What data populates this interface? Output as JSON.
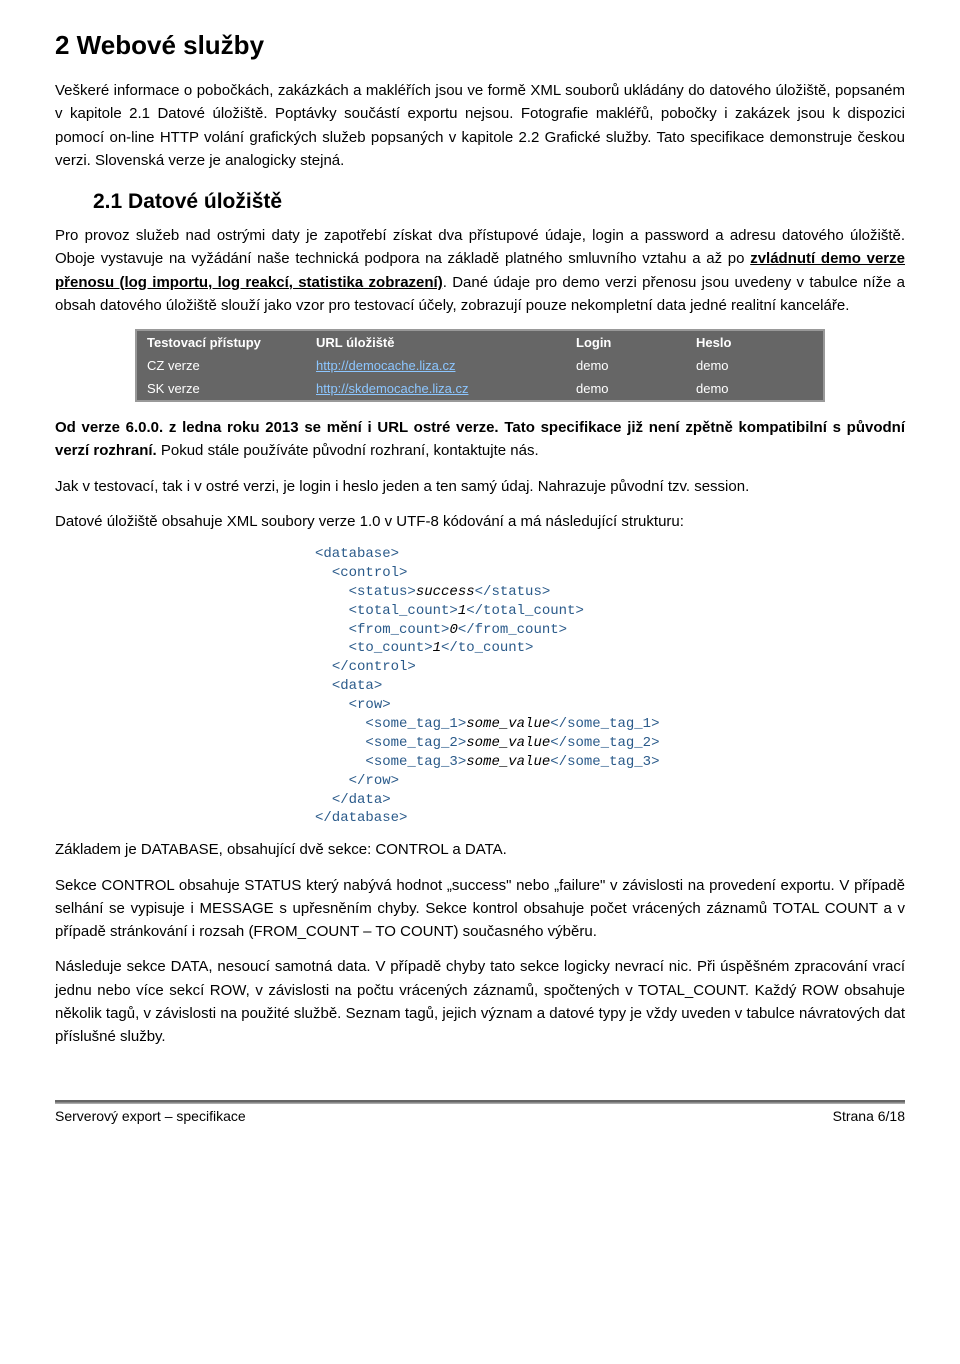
{
  "h1": "2  Webové služby",
  "p1": "Veškeré informace o pobočkách, zakázkách a makléřích jsou ve formě XML souborů ukládány do datového úložiště, popsaném v kapitole 2.1 Datové úložiště. Poptávky součástí exportu nejsou. Fotografie makléřů, pobočky i zakázek jsou k dispozici pomocí on-line HTTP volání grafických služeb popsaných v kapitole 2.2 Grafické služby. Tato specifikace demonstruje českou verzi. Slovenská verze je analogicky stejná.",
  "h2": "2.1  Datové úložiště",
  "p2_a": "Pro provoz služeb nad ostrými daty je zapotřebí získat dva přístupové údaje, login a password a adresu datového úložiště. Oboje vystavuje na vyžádání naše technická podpora na základě platného smluvního vztahu a až po ",
  "p2_u": "zvládnutí demo verze přenosu (log importu, log reakcí, statistika zobrazení)",
  "p2_b": ". Dané údaje pro demo verzi přenosu jsou uvedeny v tabulce níže a obsah datového úložiště slouží jako vzor pro testovací účely, zobrazují pouze nekompletní data jedné realitní kanceláře.",
  "table": {
    "head": [
      "Testovací přístupy",
      "URL úložiště",
      "Login",
      "Heslo"
    ],
    "rows": [
      [
        "CZ verze",
        "http://democache.liza.cz",
        "demo",
        "demo"
      ],
      [
        "SK verze",
        "http://skdemocache.liza.cz",
        "demo",
        "demo"
      ]
    ]
  },
  "p3_b": "Od verze 6.0.0. z ledna roku 2013 se mění i URL ostré verze. Tato specifikace již není zpětně kompatibilní s původní verzí rozhraní.",
  "p3_n": " Pokud stále používáte původní rozhraní, kontaktujte nás.",
  "p4": "Jak v testovací, tak i v ostré verzi, je login i heslo jeden a ten samý údaj. Nahrazuje původní tzv. session.",
  "p5": "Datové úložiště obsahuje XML soubory verze 1.0 v UTF-8 kódování a má následující strukturu:",
  "xml": {
    "l1o": "<database>",
    "l2o": "<control>",
    "l3o": "<status>",
    "l3v": "success",
    "l3c": "</status>",
    "l4o": "<total_count>",
    "l4v": "1",
    "l4c": "</total_count>",
    "l5o": "<from_count>",
    "l5v": "0",
    "l5c": "</from_count>",
    "l6o": "<to_count>",
    "l6v": "1",
    "l6c": "</to_count>",
    "l2c": "</control>",
    "l7o": "<data>",
    "l8o": "<row>",
    "l9o": "<some_tag_1>",
    "l9v": "some_value",
    "l9c": "</some_tag_1>",
    "l10o": "<some_tag_2>",
    "l10v": "some_value",
    "l10c": "</some_tag_2>",
    "l11o": "<some_tag_3>",
    "l11v": "some_value",
    "l11c": "</some_tag_3>",
    "l8c": "</row>",
    "l7c": "</data>",
    "l1c": "</database>"
  },
  "p6": "Základem je DATABASE, obsahující dvě sekce: CONTROL a DATA.",
  "p7": "Sekce CONTROL obsahuje STATUS který nabývá hodnot „success\" nebo „failure\" v závislosti na provedení exportu. V případě selhání se vypisuje i MESSAGE s upřesněním chyby. Sekce kontrol obsahuje počet vrácených záznamů TOTAL COUNT a v případě stránkování i rozsah (FROM_COUNT – TO COUNT) současného výběru.",
  "p8": "Následuje sekce DATA, nesoucí samotná data. V případě chyby tato sekce logicky nevrací nic. Při úspěšném zpracování vrací jednu nebo více sekcí ROW, v závislosti na počtu vrácených záznamů, spočtených v TOTAL_COUNT. Každý ROW obsahuje několik tagů, v závislosti na použité službě. Seznam tagů, jejich význam a datové typy je vždy uveden v tabulce návratových dat příslušné služby.",
  "footer": {
    "left": "Serverový export – specifikace",
    "right": "Strana 6/18"
  }
}
